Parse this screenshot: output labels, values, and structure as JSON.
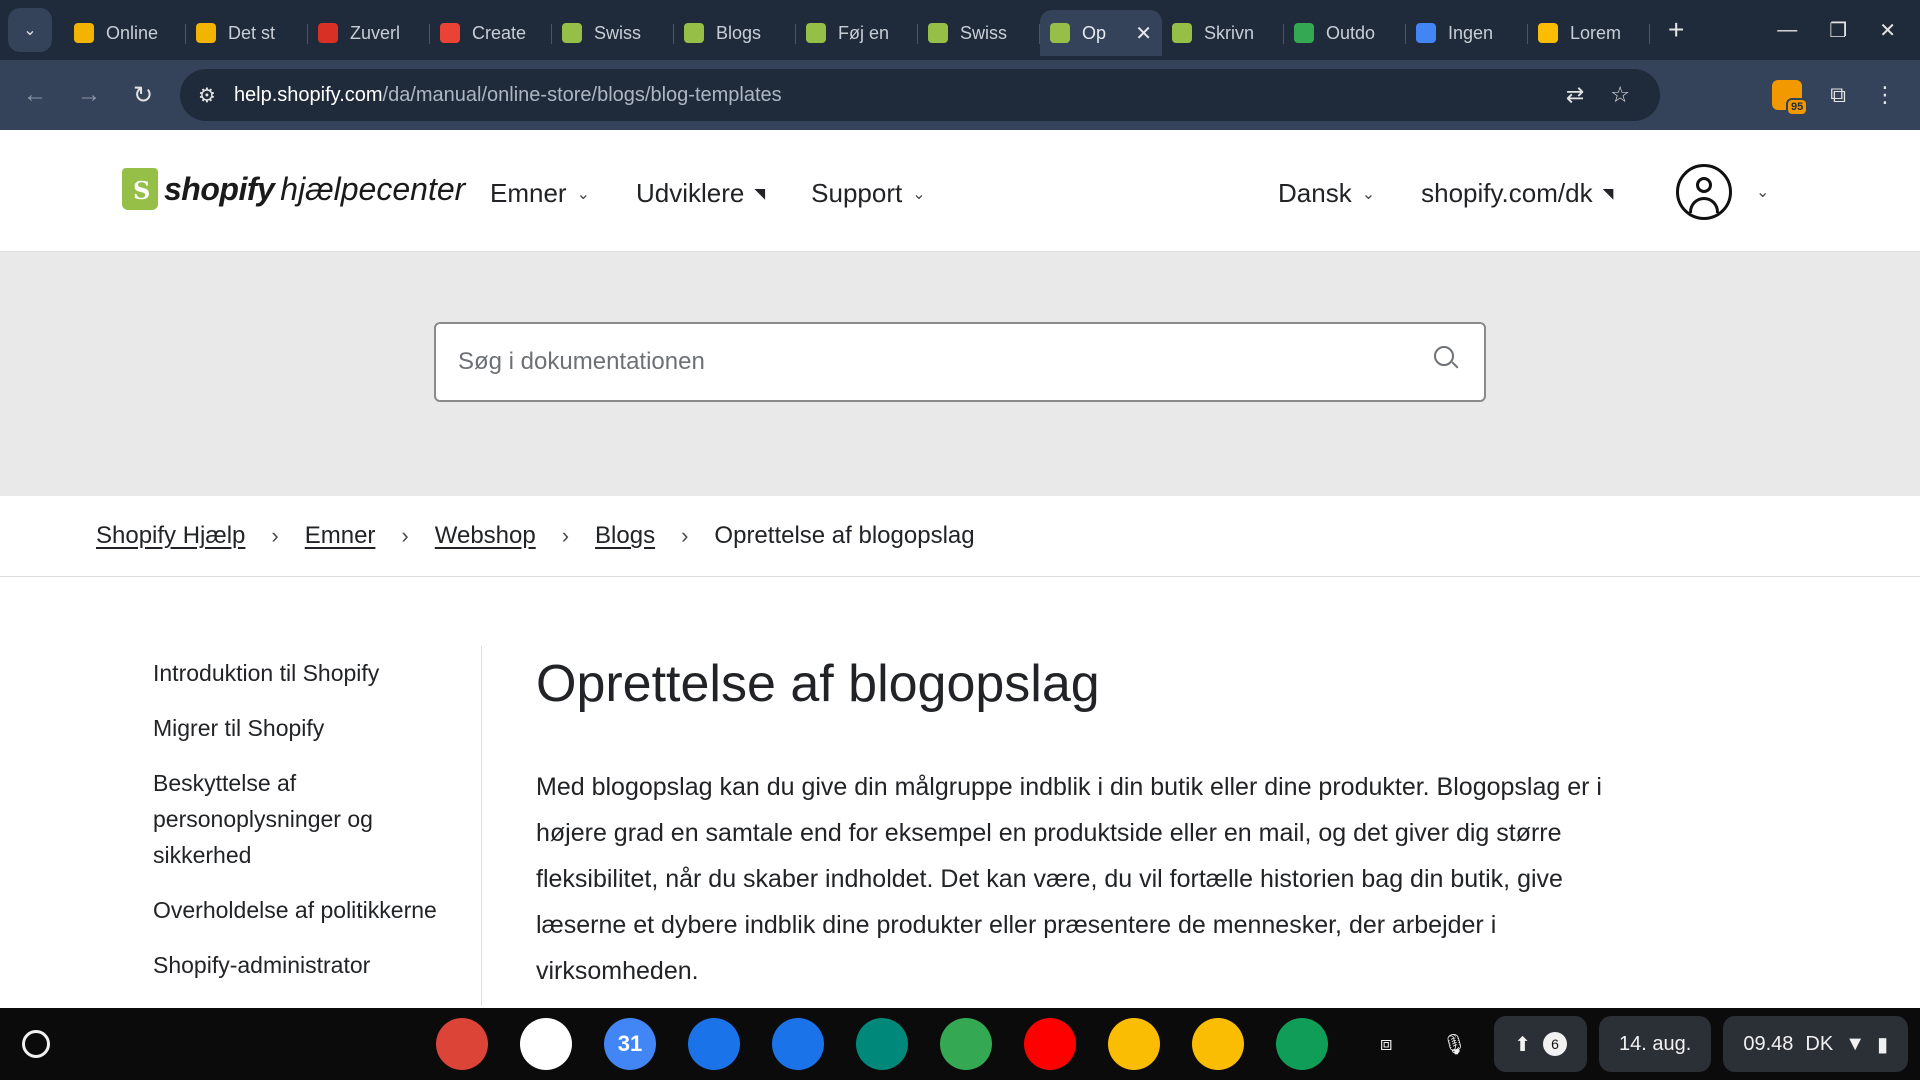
{
  "browser": {
    "tabs": [
      {
        "title": "Online",
        "color": "#f2b400"
      },
      {
        "title": "Det st",
        "color": "#f2b400"
      },
      {
        "title": "Zuverl",
        "color": "#d93025"
      },
      {
        "title": "Create",
        "color": "#ea4335"
      },
      {
        "title": "Swiss",
        "color": "#95bf47"
      },
      {
        "title": "Blogs",
        "color": "#95bf47"
      },
      {
        "title": "Føj en",
        "color": "#95bf47"
      },
      {
        "title": "Swiss",
        "color": "#95bf47"
      },
      {
        "title": "Op",
        "color": "#95bf47",
        "active": true
      },
      {
        "title": "Skrivn",
        "color": "#95bf47"
      },
      {
        "title": "Outdo",
        "color": "#34a853"
      },
      {
        "title": "Ingen",
        "color": "#4285f4"
      },
      {
        "title": "Lorem",
        "color": "#fbbc04"
      }
    ],
    "url_host": "help.shopify.com",
    "url_path": "/da/manual/online-store/blogs/blog-templates",
    "extension_badge": "95"
  },
  "header": {
    "logo_word": "shopify",
    "logo_suffix": "hjælpecenter",
    "nav": [
      "Emner",
      "Udviklere",
      "Support"
    ],
    "language": "Dansk",
    "store_link": "shopify.com/dk"
  },
  "search": {
    "placeholder": "Søg i dokumentationen"
  },
  "breadcrumb": {
    "items": [
      "Shopify Hjælp",
      "Emner",
      "Webshop",
      "Blogs"
    ],
    "current": "Oprettelse af blogopslag"
  },
  "sidebar": {
    "items": [
      "Introduktion til Shopify",
      "Migrer til Shopify",
      "Beskyttelse af personoplysninger og sikkerhed",
      "Overholdelse af politikkerne",
      "Shopify-administrator"
    ]
  },
  "article": {
    "title": "Oprettelse af blogopslag",
    "body": "Med blogopslag kan du give din målgruppe indblik i din butik eller dine produkter. Blogopslag er i højere grad en samtale end for eksempel en produktside eller en mail, og det giver dig større fleksibilitet, når du skaber indholdet. Det kan være, du vil fortælle historien bag din butik, give læserne et dybere indblik dine produkter eller præsentere de mennesker, der arbejder i virksomheden."
  },
  "shelf": {
    "apps": [
      {
        "name": "chrome",
        "color": "#db4437"
      },
      {
        "name": "gmail",
        "color": "#ffffff"
      },
      {
        "name": "calendar",
        "color": "#4285f4",
        "label": "31"
      },
      {
        "name": "files",
        "color": "#1a73e8"
      },
      {
        "name": "messages",
        "color": "#1a73e8"
      },
      {
        "name": "meet",
        "color": "#00897b"
      },
      {
        "name": "play-store",
        "color": "#34a853"
      },
      {
        "name": "youtube",
        "color": "#ff0000"
      },
      {
        "name": "photos",
        "color": "#fbbc04"
      },
      {
        "name": "keep",
        "color": "#fbbc04"
      },
      {
        "name": "sheets",
        "color": "#0f9d58"
      }
    ],
    "notification_count": "6",
    "date": "14. aug.",
    "time": "09.48",
    "region": "DK"
  }
}
